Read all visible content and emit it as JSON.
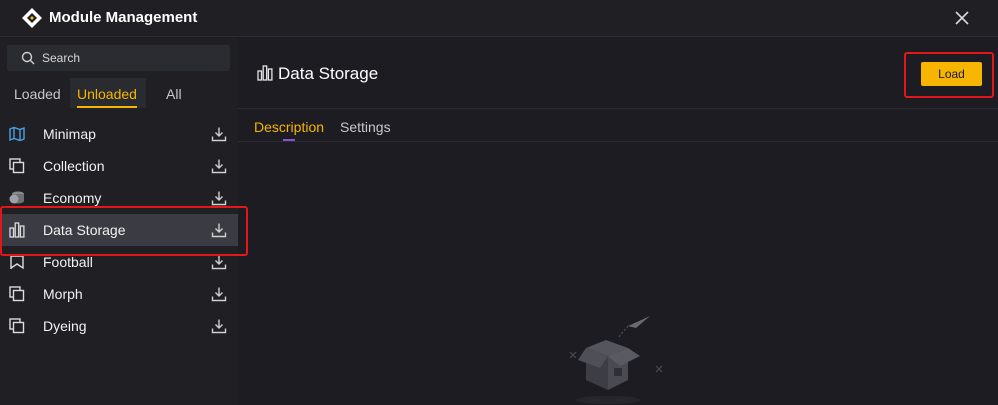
{
  "window": {
    "title": "Module Management",
    "logo_icon": "app-logo-icon",
    "close_icon": "close-icon"
  },
  "search": {
    "placeholder": "Search",
    "value": ""
  },
  "filter_tabs": [
    {
      "label": "Loaded",
      "active": false
    },
    {
      "label": "Unloaded",
      "active": true
    },
    {
      "label": "All",
      "active": false
    }
  ],
  "modules": [
    {
      "label": "Minimap",
      "icon": "map-icon",
      "selected": false
    },
    {
      "label": "Collection",
      "icon": "stacked-squares-icon",
      "selected": false
    },
    {
      "label": "Economy",
      "icon": "coins-icon",
      "selected": false
    },
    {
      "label": "Data Storage",
      "icon": "bar-chart-icon",
      "selected": true
    },
    {
      "label": "Football",
      "icon": "flag-icon",
      "selected": false
    },
    {
      "label": "Morph",
      "icon": "stacked-squares-icon",
      "selected": false
    },
    {
      "label": "Dyeing",
      "icon": "stacked-squares-icon",
      "selected": false
    }
  ],
  "detail": {
    "title": "Data Storage",
    "icon": "bar-chart-icon",
    "load_label": "Load",
    "tabs": [
      {
        "label": "Description",
        "active": true
      },
      {
        "label": "Settings",
        "active": false
      }
    ],
    "empty_icon": "empty-box-icon"
  },
  "colors": {
    "accent": "#f7b500",
    "highlight": "#e01818",
    "tab_indicator": "#8a4fd8",
    "background": "#1c1c22"
  }
}
